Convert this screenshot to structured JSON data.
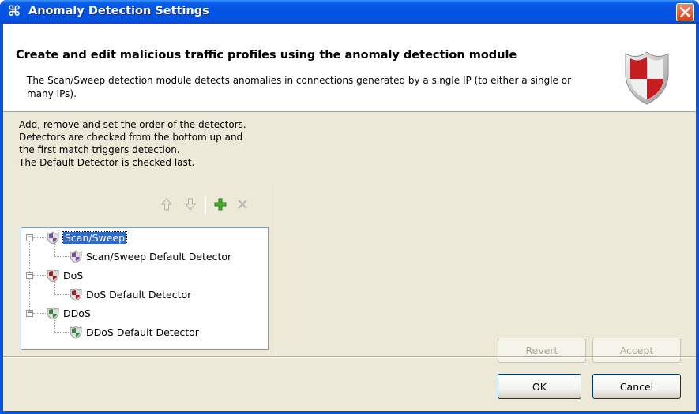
{
  "window": {
    "title": "Anomaly Detection Settings"
  },
  "banner": {
    "heading": "Create and edit malicious traffic profiles using the anomaly detection module",
    "description": "The Scan/Sweep detection module detects anomalies in connections generated by a single IP (to either a single or many IPs)."
  },
  "instructions": [
    "Add, remove and set the order of the detectors.",
    "Detectors are checked from the bottom up and",
    "the first match triggers detection.",
    "The Default Detector is checked last."
  ],
  "toolbar": {
    "icons": [
      "move-up-icon",
      "move-down-icon",
      "add-icon",
      "remove-icon"
    ]
  },
  "tree": [
    {
      "label": "Scan/Sweep",
      "color": "#7a4fa0",
      "selected": true,
      "children": [
        {
          "label": "Scan/Sweep Default Detector",
          "color": "#7a4fa0"
        }
      ]
    },
    {
      "label": "DoS",
      "color": "#a31d1d",
      "selected": false,
      "children": [
        {
          "label": "DoS Default Detector",
          "color": "#a31d1d"
        }
      ]
    },
    {
      "label": "DDoS",
      "color": "#2f8a3c",
      "selected": false,
      "children": [
        {
          "label": "DDoS Default Detector",
          "color": "#2f8a3c"
        }
      ]
    }
  ],
  "buttons": {
    "revert": "Revert",
    "accept": "Accept",
    "ok": "OK",
    "cancel": "Cancel"
  }
}
